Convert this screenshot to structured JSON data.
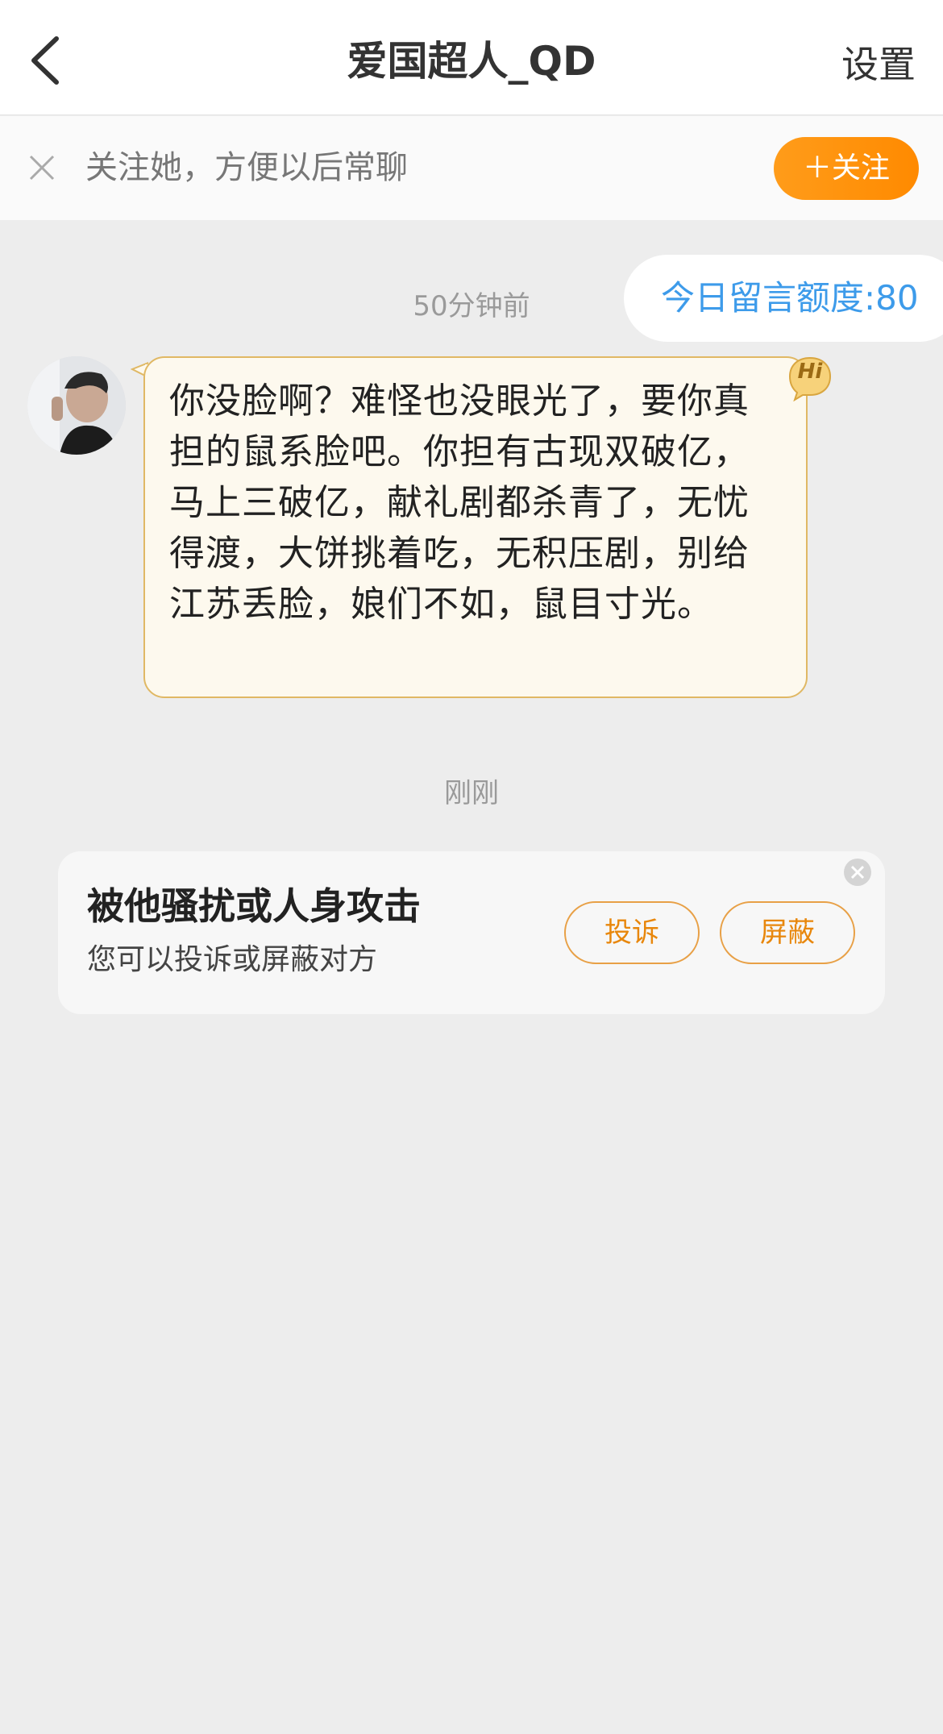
{
  "header": {
    "title": "爱国超人_QD",
    "settings_label": "设置"
  },
  "follow_bar": {
    "text": "关注她，方便以后常聊",
    "button_label": "＋关注"
  },
  "quota": {
    "text": "今日留言额度:80"
  },
  "timestamps": [
    "50分钟前",
    "刚刚"
  ],
  "message": {
    "text": "你没脸啊？难怪也没眼光了，要你真担的鼠系脸吧。你担有古现双破亿，马上三破亿，献礼剧都杀青了，无忧得渡，大饼挑着吃，无积压剧，别给江苏丢脸，娘们不如，鼠目寸光。",
    "badge": "Hi"
  },
  "harassment_card": {
    "title": "被他骚扰或人身攻击",
    "subtitle": "您可以投诉或屏蔽对方",
    "report_label": "投诉",
    "block_label": "屏蔽"
  },
  "colors": {
    "accent": "#ff9c1a",
    "quota_text": "#3d9bea",
    "bubble_bg": "#fdf9ee",
    "bubble_border": "#e0b864",
    "background": "#ededed"
  },
  "icons": [
    "back-arrow-icon",
    "close-icon",
    "hi-badge-icon",
    "close-circle-icon"
  ]
}
